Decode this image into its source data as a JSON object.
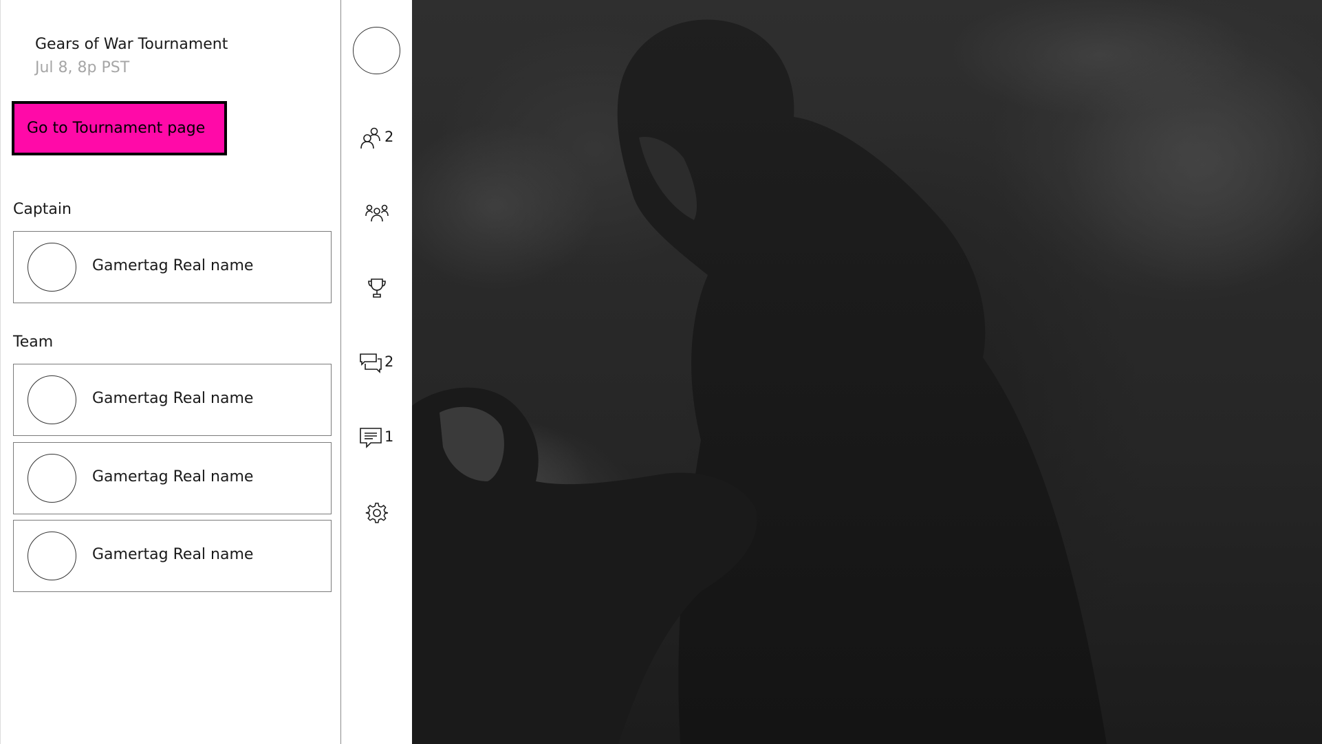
{
  "event": {
    "title": "Gears of War Tournament",
    "date": "Jul 8, 8p PST",
    "button_label": "Go to Tournament page"
  },
  "captain": {
    "label": "Captain",
    "member": {
      "name": "Gamertag Real name"
    }
  },
  "team": {
    "label": "Team",
    "members": [
      {
        "name": "Gamertag Real name"
      },
      {
        "name": "Gamertag Real name"
      },
      {
        "name": "Gamertag Real name"
      }
    ]
  },
  "rail": {
    "items": [
      {
        "icon": "friends-icon",
        "count": "2"
      },
      {
        "icon": "clubs-icon",
        "count": ""
      },
      {
        "icon": "trophy-icon",
        "count": ""
      },
      {
        "icon": "chat-icon",
        "count": "2"
      },
      {
        "icon": "message-icon",
        "count": "1"
      },
      {
        "icon": "gear-icon",
        "count": ""
      }
    ]
  },
  "colors": {
    "accent": "#ff0aa8",
    "text": "#1a1a1a",
    "muted_text": "#a6a6a6",
    "hero_background": "#2a2a2a"
  }
}
